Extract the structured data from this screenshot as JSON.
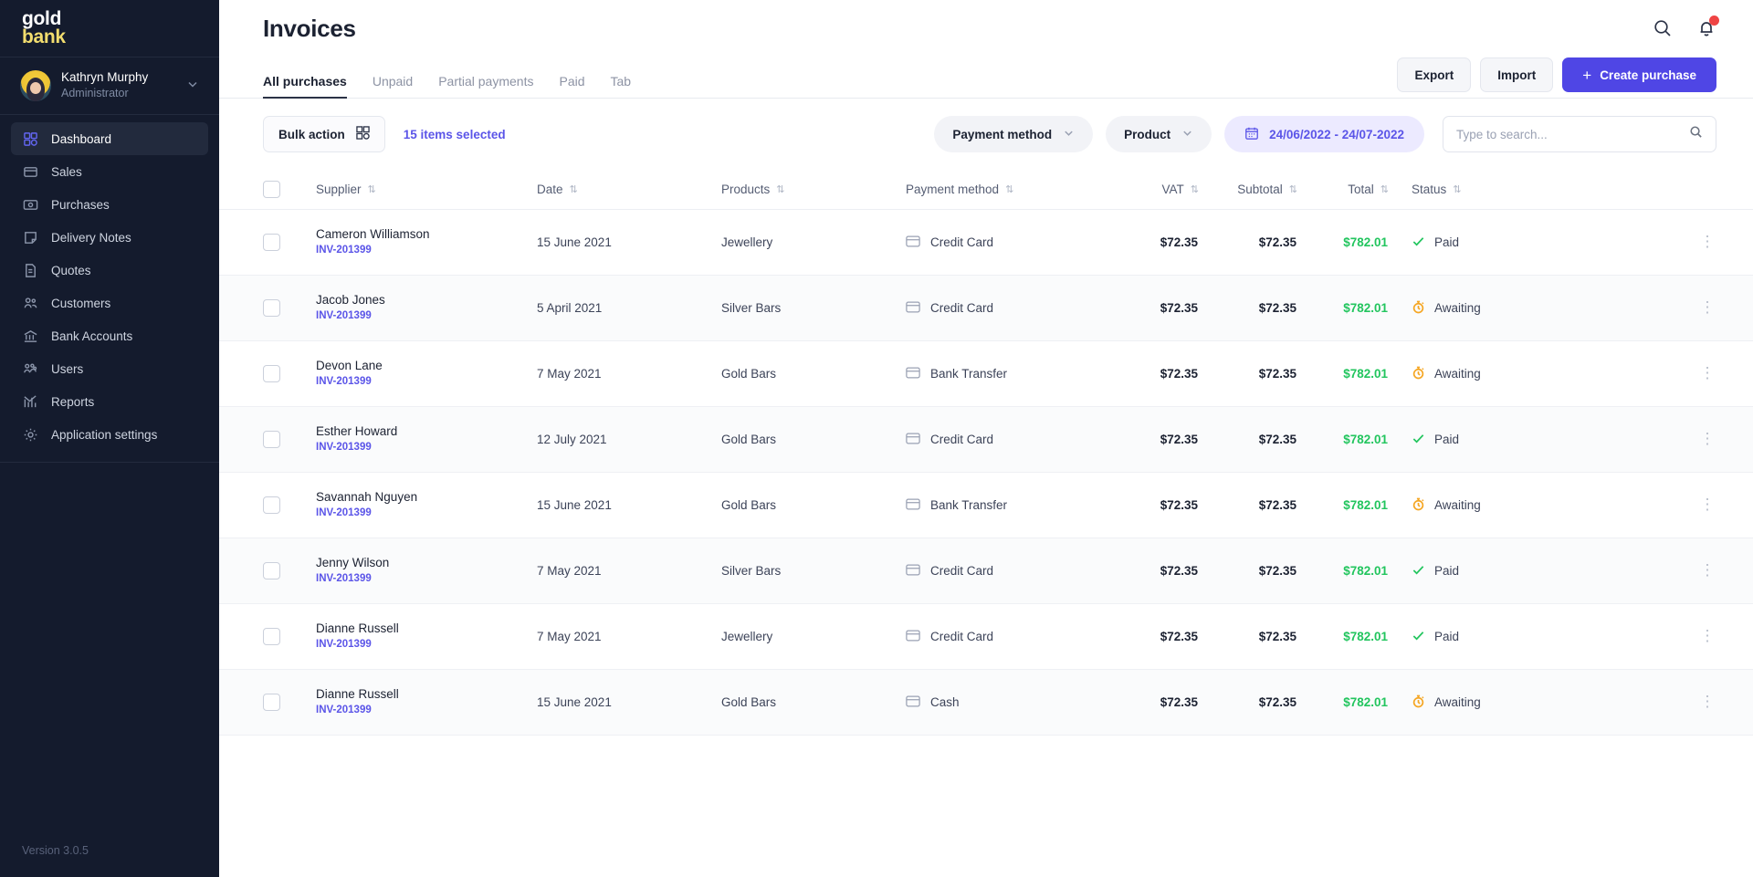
{
  "sidebar": {
    "logo": {
      "line1": "gold",
      "line2": "bank"
    },
    "profile": {
      "name": "Kathryn Murphy",
      "role": "Administrator"
    },
    "items": [
      {
        "label": "Dashboard",
        "icon": "dashboard-icon",
        "active": true
      },
      {
        "label": "Sales",
        "icon": "card-icon",
        "active": false
      },
      {
        "label": "Purchases",
        "icon": "money-icon",
        "active": false
      },
      {
        "label": "Delivery Notes",
        "icon": "note-icon",
        "active": false
      },
      {
        "label": "Quotes",
        "icon": "document-icon",
        "active": false
      },
      {
        "label": "Customers",
        "icon": "users-icon",
        "active": false
      },
      {
        "label": "Bank Accounts",
        "icon": "bank-icon",
        "active": false
      },
      {
        "label": "Users",
        "icon": "group-icon",
        "active": false
      },
      {
        "label": "Reports",
        "icon": "chart-icon",
        "active": false
      },
      {
        "label": "Application settings",
        "icon": "gear-icon",
        "active": false
      }
    ],
    "version": "Version 3.0.5"
  },
  "header": {
    "title": "Invoices"
  },
  "tabs": [
    {
      "label": "All purchases",
      "active": true
    },
    {
      "label": "Unpaid",
      "active": false
    },
    {
      "label": "Partial payments",
      "active": false
    },
    {
      "label": "Paid",
      "active": false
    },
    {
      "label": "Tab",
      "active": false
    }
  ],
  "actions": {
    "export_label": "Export",
    "import_label": "Import",
    "create_label": "Create purchase",
    "create_plus": "+"
  },
  "filters": {
    "bulk_label": "Bulk action",
    "selected_text": "15 items selected",
    "payment_method_label": "Payment method",
    "product_label": "Product",
    "date_range": "24/06/2022 - 24/07-2022",
    "search_placeholder": "Type to search...",
    "search_value": ""
  },
  "table": {
    "columns": [
      "Supplier",
      "Date",
      "Products",
      "Payment method",
      "VAT",
      "Subtotal",
      "Total",
      "Status"
    ],
    "rows": [
      {
        "supplier": "Cameron Williamson",
        "invoice": "INV-201399",
        "date": "15 June 2021",
        "product": "Jewellery",
        "payment": "Credit Card",
        "vat": "$72.35",
        "subtotal": "$72.35",
        "total": "$782.01",
        "status": "Paid"
      },
      {
        "supplier": "Jacob Jones",
        "invoice": "INV-201399",
        "date": "5 April 2021",
        "product": "Silver Bars",
        "payment": "Credit Card",
        "vat": "$72.35",
        "subtotal": "$72.35",
        "total": "$782.01",
        "status": "Awaiting"
      },
      {
        "supplier": "Devon Lane",
        "invoice": "INV-201399",
        "date": "7 May 2021",
        "product": "Gold Bars",
        "payment": "Bank Transfer",
        "vat": "$72.35",
        "subtotal": "$72.35",
        "total": "$782.01",
        "status": "Awaiting"
      },
      {
        "supplier": "Esther Howard",
        "invoice": "INV-201399",
        "date": "12 July 2021",
        "product": "Gold Bars",
        "payment": "Credit Card",
        "vat": "$72.35",
        "subtotal": "$72.35",
        "total": "$782.01",
        "status": "Paid"
      },
      {
        "supplier": "Savannah Nguyen",
        "invoice": "INV-201399",
        "date": "15 June 2021",
        "product": "Gold Bars",
        "payment": "Bank Transfer",
        "vat": "$72.35",
        "subtotal": "$72.35",
        "total": "$782.01",
        "status": "Awaiting"
      },
      {
        "supplier": "Jenny Wilson",
        "invoice": "INV-201399",
        "date": "7 May 2021",
        "product": "Silver Bars",
        "payment": "Credit Card",
        "vat": "$72.35",
        "subtotal": "$72.35",
        "total": "$782.01",
        "status": "Paid"
      },
      {
        "supplier": "Dianne Russell",
        "invoice": "INV-201399",
        "date": "7 May 2021",
        "product": "Jewellery",
        "payment": "Credit Card",
        "vat": "$72.35",
        "subtotal": "$72.35",
        "total": "$782.01",
        "status": "Paid"
      },
      {
        "supplier": "Dianne Russell",
        "invoice": "INV-201399",
        "date": "15 June 2021",
        "product": "Gold Bars",
        "payment": "Cash",
        "vat": "$72.35",
        "subtotal": "$72.35",
        "total": "$782.01",
        "status": "Awaiting"
      }
    ]
  },
  "colors": {
    "accent": "#4f46e5",
    "accent_light": "#5b55e8",
    "sidebar_bg": "#141b2d",
    "paid_green": "#22c55e",
    "awaiting_orange": "#f5a623",
    "notification_red": "#ef4444",
    "logo_yellow": "#f2dd6e"
  }
}
